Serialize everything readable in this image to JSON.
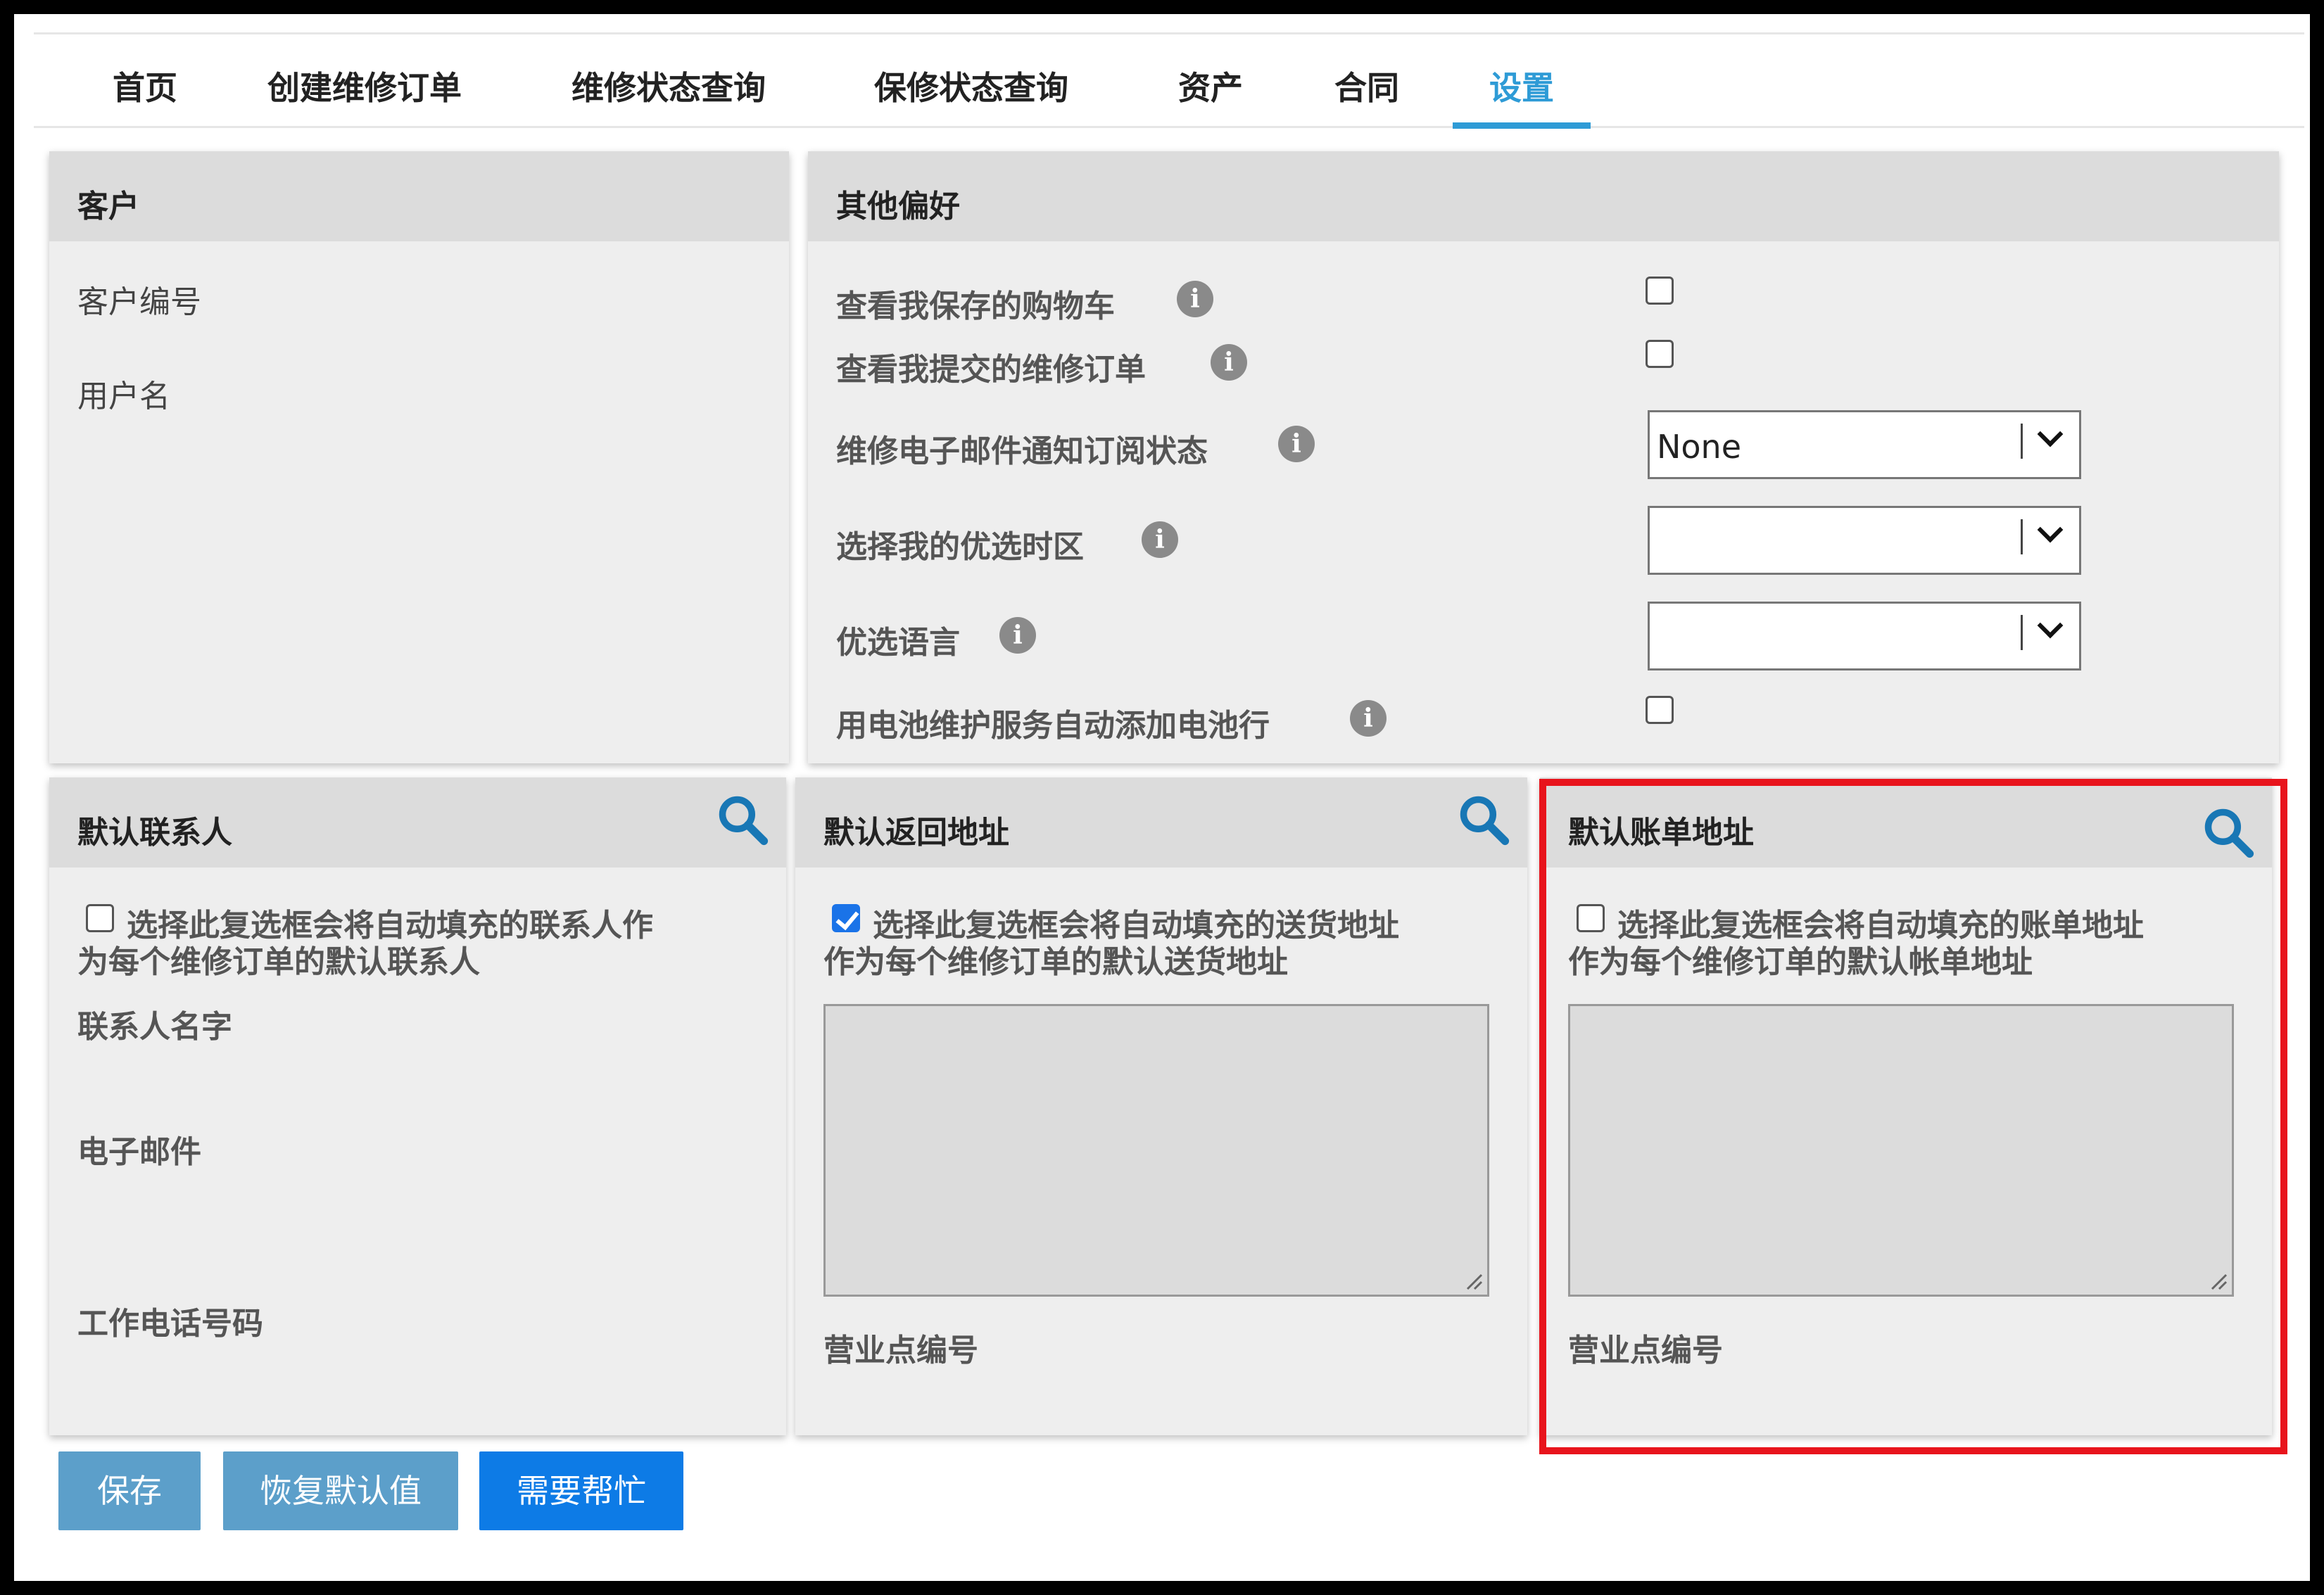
{
  "tabs": {
    "home": "首页",
    "create_order": "创建维修订单",
    "repair_status": "维修状态查询",
    "warranty_status": "保修状态查询",
    "assets": "资产",
    "contracts": "合同",
    "settings": "设置"
  },
  "customer": {
    "title": "客户",
    "customer_number_label": "客户编号",
    "username_label": "用户名"
  },
  "preferences": {
    "title": "其他偏好",
    "view_saved_carts": "查看我保存的购物车",
    "view_submitted_orders": "查看我提交的维修订单",
    "email_subscription": "维修电子邮件通知订阅状态",
    "email_subscription_value": "None",
    "timezone": "选择我的优选时区",
    "timezone_value": "",
    "language": "优选语言",
    "language_value": "",
    "battery_service": "用电池维护服务自动添加电池行"
  },
  "default_contact": {
    "title": "默认联系人",
    "checkbox_text": "选择此复选框会将自动填充的联系人作为每个维修订单的默认联系人",
    "checkbox_line1": "选择此复选框会将自动填充的联系人作",
    "checkbox_line2": "为每个维修订单的默认联系人",
    "name_label": "联系人名字",
    "email_label": "电子邮件",
    "phone_label": "工作电话号码"
  },
  "default_return": {
    "title": "默认返回地址",
    "checkbox_line1": "选择此复选框会将自动填充的送货地址",
    "checkbox_line2": "作为每个维修订单的默认送货地址",
    "checked": true,
    "site_label": "营业点编号"
  },
  "default_billing": {
    "title": "默认账单地址",
    "checkbox_line1": "选择此复选框会将自动填充的账单地址",
    "checkbox_line2": "作为每个维修订单的默认帐单地址",
    "checked": false,
    "site_label": "营业点编号"
  },
  "buttons": {
    "save": "保存",
    "restore": "恢复默认值",
    "help": "需要帮忙"
  },
  "colors": {
    "accent": "#2e9bd6",
    "primary_button": "#0d7be6",
    "muted_button": "#5c9fca",
    "highlight": "#e8141c"
  }
}
